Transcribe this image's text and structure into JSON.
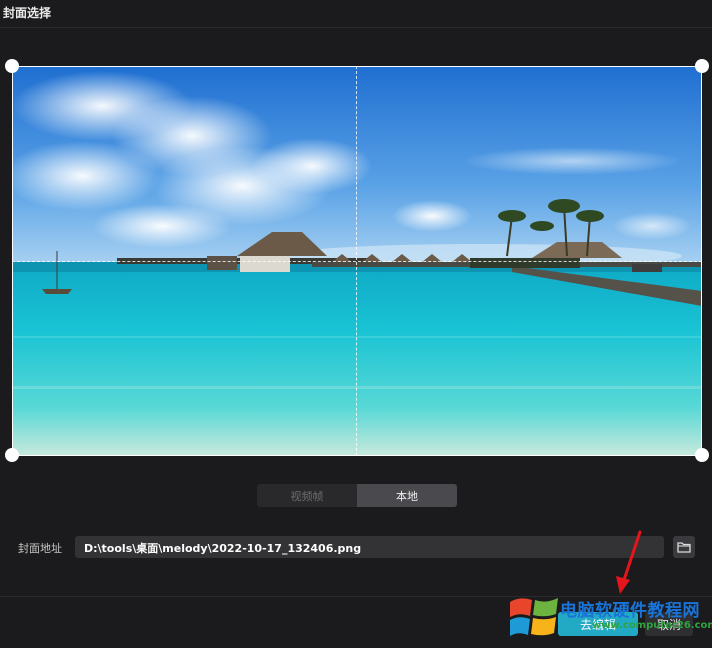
{
  "dialog": {
    "title": "封面选择"
  },
  "source_tabs": [
    {
      "label": "视频帧",
      "active": false
    },
    {
      "label": "本地",
      "active": true
    }
  ],
  "cover_path": {
    "label": "封面地址",
    "value": "D:\\tools\\桌面\\melody\\2022-10-17_132406.png"
  },
  "buttons": {
    "edit_label": "去编辑",
    "cancel_label": "取消"
  },
  "watermark": {
    "text": "电脑软硬件教程网",
    "url": "www.computer26.com"
  },
  "icons": {
    "browse": "folder-icon",
    "annotation": "red-arrow-icon"
  },
  "colors": {
    "background": "#1b1b1d",
    "accent": "#22a9c4",
    "arrow": "#e5161b"
  }
}
